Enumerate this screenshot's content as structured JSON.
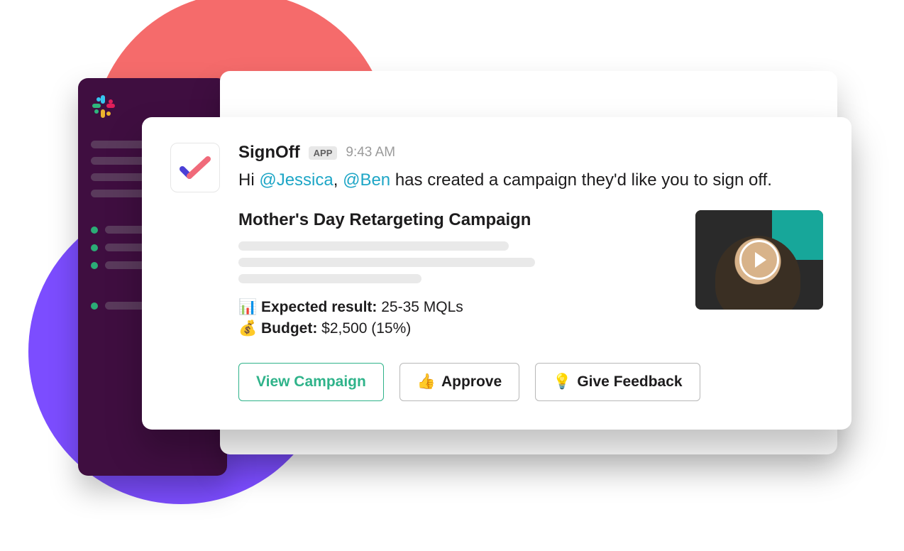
{
  "message": {
    "app_name": "SignOff",
    "app_badge": "APP",
    "timestamp": "9:43 AM",
    "text_prefix": "Hi ",
    "mention1": "@Jessica",
    "text_sep": ", ",
    "mention2": "@Ben",
    "text_suffix": " has created a campaign they'd like you to sign off."
  },
  "campaign": {
    "title": "Mother's Day Retargeting Campaign",
    "expected_icon": "📊",
    "expected_label": "Expected result:",
    "expected_value": "25-35 MQLs",
    "budget_icon": "💰",
    "budget_label": "Budget:",
    "budget_value": "$2,500 (15%)"
  },
  "actions": {
    "view": "View Campaign",
    "approve_icon": "👍",
    "approve": "Approve",
    "feedback_icon": "💡",
    "feedback": "Give Feedback"
  }
}
